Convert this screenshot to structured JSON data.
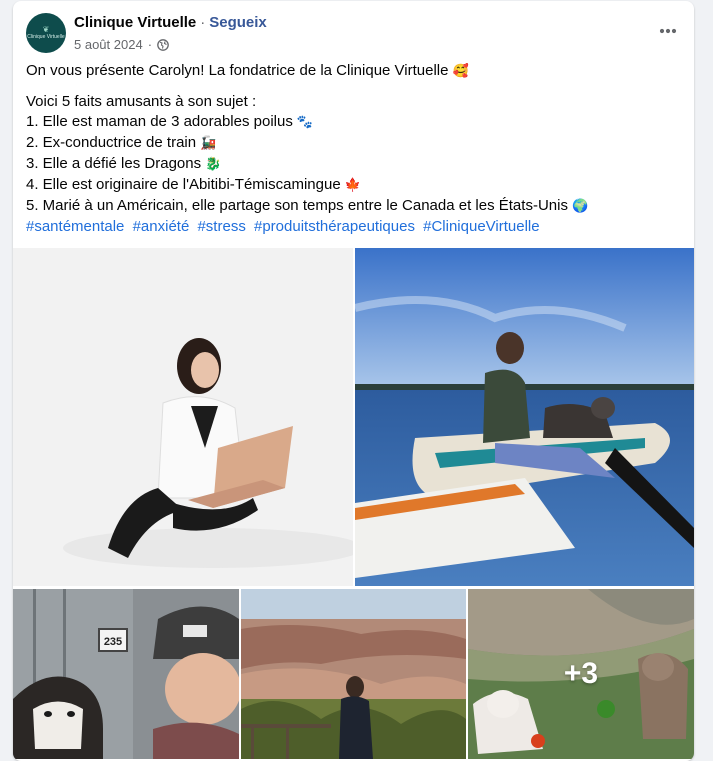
{
  "post": {
    "author": "Clinique Virtuelle",
    "separator": "·",
    "location": "Segueix",
    "date": "5 août 2024",
    "date_dot": "·",
    "avatar_text": "Clinique Virtuelle",
    "privacy_icon": "globe-icon",
    "more_icon": "more-options-icon"
  },
  "text": {
    "intro": "On vous présente Carolyn! La fondatrice de la Clinique Virtuelle",
    "intro_emoji": "🥰",
    "facts_title": "Voici 5 faits amusants à son sujet :",
    "facts": [
      {
        "text": "1. Elle est maman de 3 adorables poilus",
        "emoji": "🐾"
      },
      {
        "text": "2. Ex-conductrice de train",
        "emoji": "🚂"
      },
      {
        "text": "3. Elle a défié les Dragons",
        "emoji": "🐉"
      },
      {
        "text": "4. Elle est originaire de l'Abitibi-Témiscamingue",
        "emoji": "🍁"
      },
      {
        "text": "5. Marié à un Américain, elle partage son temps entre le Canada et les États-Unis",
        "emoji": "🌍"
      }
    ],
    "hashtags": [
      "#santémentale",
      "#anxiété",
      "#stress",
      "#produitsthérapeutiques",
      "#CliniqueVirtuelle"
    ]
  },
  "photos": {
    "more_count": "+3"
  },
  "colors": {
    "link": "#216fdb",
    "location": "#385898",
    "secondary_text": "#65676b",
    "avatar_bg": "#0e4c4c"
  }
}
